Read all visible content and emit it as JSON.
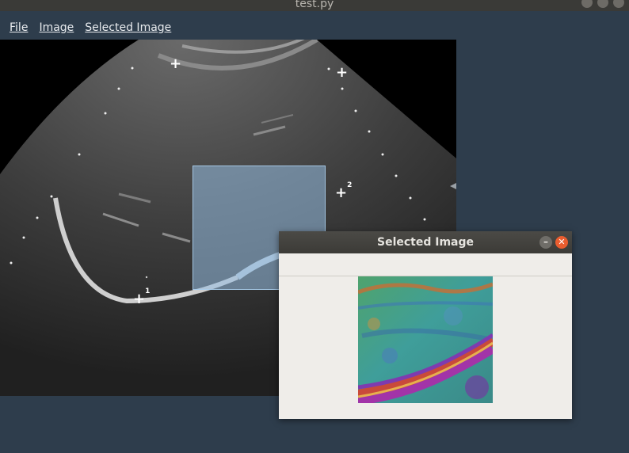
{
  "window": {
    "title": "test.py"
  },
  "menu": {
    "file": "File",
    "image": "Image",
    "selected_image": "Selected Image"
  },
  "markers": [
    {
      "number": "1"
    },
    {
      "number": "2"
    }
  ],
  "dialog": {
    "title": "Selected Image"
  }
}
